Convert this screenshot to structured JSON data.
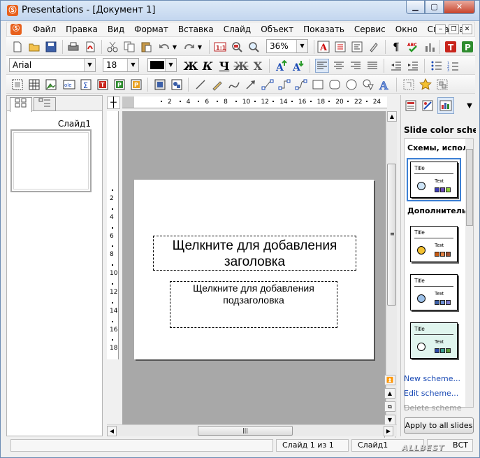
{
  "window": {
    "title": "Presentations - [Документ 1]"
  },
  "menu": {
    "items": [
      "Файл",
      "Правка",
      "Вид",
      "Формат",
      "Вставка",
      "Слайд",
      "Объект",
      "Показать",
      "Сервис",
      "Окно",
      "Справка"
    ]
  },
  "toolbar": {
    "zoom": "36%",
    "font_family": "Arial",
    "font_size": "18",
    "btn_bold": "Ж",
    "btn_italic": "К",
    "btn_underline": "Ч",
    "btn_strike": "Ж",
    "btn_clear": "Х"
  },
  "rulers": {
    "h_ticks": [
      "2",
      "4",
      "6",
      "8",
      "10",
      "12",
      "14",
      "16",
      "18",
      "20",
      "22",
      "24"
    ],
    "v_ticks": [
      "2",
      "4",
      "6",
      "8",
      "10",
      "12",
      "14",
      "16",
      "18"
    ]
  },
  "slides_panel": {
    "slide_label": "Слайд1"
  },
  "slide": {
    "title_placeholder": "Щелкните для добавления заголовка",
    "subtitle_placeholder": "Щелкните для добавления подзаголовка"
  },
  "right_panel": {
    "title": "Slide color schemes",
    "section_used": "Схемы, испол",
    "section_more": "Дополнитель",
    "scheme_title": "Title",
    "scheme_text": "Text",
    "links": {
      "new": "New scheme...",
      "edit": "Edit scheme...",
      "delete": "Delete scheme"
    },
    "apply_button": "Apply to all slides"
  },
  "statusbar": {
    "slide_of": "Слайд 1 из 1",
    "slide_name": "Слайд1",
    "mode": "ВСТ"
  },
  "watermark": "ALLBEST",
  "colors": {
    "accent": "#3c7fd4",
    "canvas": "#a8a8a8",
    "app_icon": "#e8601c"
  }
}
